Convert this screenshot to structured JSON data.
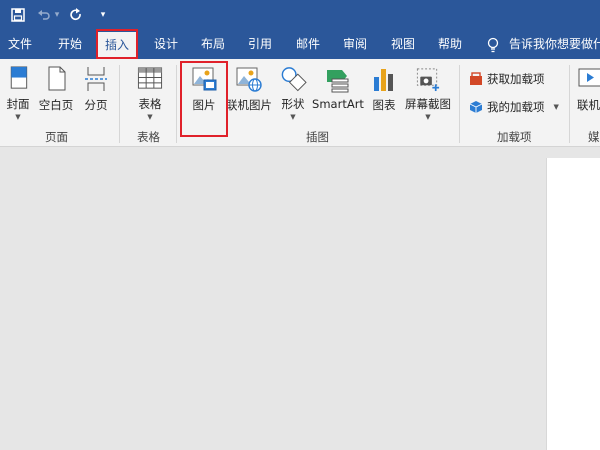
{
  "quick_access": {
    "undo_dropdown": "▾",
    "customize": "▾"
  },
  "tabs": [
    {
      "label": "文件"
    },
    {
      "label": "开始"
    },
    {
      "label": "插入"
    },
    {
      "label": "设计"
    },
    {
      "label": "布局"
    },
    {
      "label": "引用"
    },
    {
      "label": "邮件"
    },
    {
      "label": "审阅"
    },
    {
      "label": "视图"
    },
    {
      "label": "帮助"
    }
  ],
  "tell_me": "告诉我你想要做什",
  "ribbon": {
    "pages": {
      "cover": "封面",
      "blank": "空白页",
      "break": "分页",
      "group": "页面"
    },
    "tables": {
      "table": "表格",
      "group": "表格"
    },
    "illustrations": {
      "picture": "图片",
      "online_picture": "联机图片",
      "shapes": "形状",
      "smartart": "SmartArt",
      "chart": "图表",
      "screenshot": "屏幕截图",
      "group": "插图"
    },
    "addins": {
      "get": "获取加载项",
      "my": "我的加载项",
      "group": "加载项"
    },
    "media": {
      "online_video": "联机",
      "group": "媒"
    }
  },
  "colors": {
    "title_bar": "#2b579a",
    "ribbon": "#f3f3f3",
    "highlight": "#e0212a",
    "workspace": "#e6e6e6"
  }
}
